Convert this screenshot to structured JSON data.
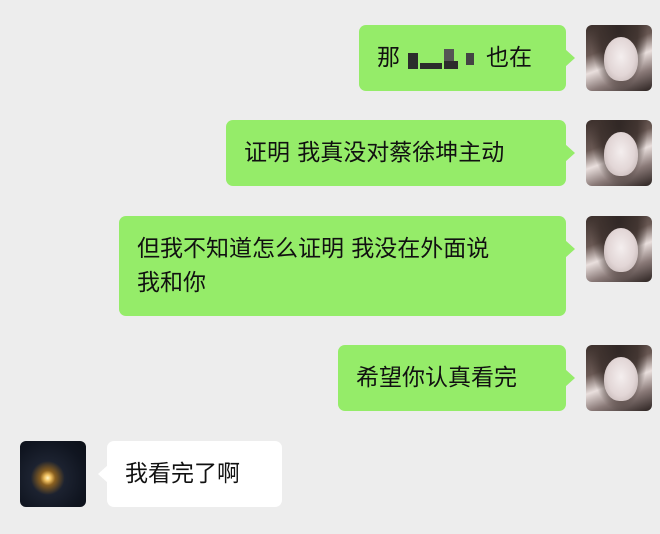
{
  "messages": [
    {
      "from": "me",
      "text_before": "那",
      "text_after": "也在",
      "redacted": true
    },
    {
      "from": "me",
      "text": "证明 我真没对蔡徐坤主动"
    },
    {
      "from": "me",
      "line1": "但我不知道怎么证明 我没在外面说",
      "line2": "我和你"
    },
    {
      "from": "me",
      "text": "希望你认真看完"
    },
    {
      "from": "them",
      "text": "我看完了啊"
    }
  ],
  "colors": {
    "background": "#ededed",
    "outgoing_bubble": "#95ec69",
    "incoming_bubble": "#ffffff"
  },
  "avatars": {
    "me": "profile-photo-woman",
    "them": "profile-photo-dark-light"
  }
}
